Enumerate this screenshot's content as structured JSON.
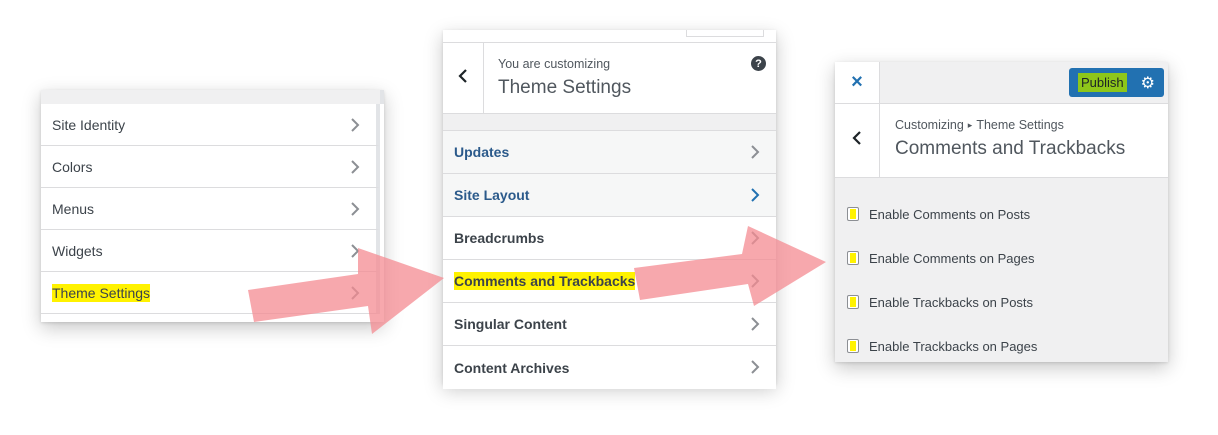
{
  "panel1": {
    "items": [
      {
        "label": "Site Identity"
      },
      {
        "label": "Colors"
      },
      {
        "label": "Menus"
      },
      {
        "label": "Widgets"
      },
      {
        "label": "Theme Settings",
        "highlighted": true
      }
    ]
  },
  "panel2": {
    "header": {
      "subtitle": "You are customizing",
      "title": "Theme Settings",
      "help_icon": "?"
    },
    "items": [
      {
        "label": "Updates"
      },
      {
        "label": "Site Layout"
      },
      {
        "label": "Breadcrumbs"
      },
      {
        "label": "Comments and Trackbacks",
        "highlighted": true
      },
      {
        "label": "Singular Content"
      },
      {
        "label": "Content Archives"
      }
    ]
  },
  "panel3": {
    "close_icon": "×",
    "publish_label": "Publish",
    "gear_icon": "⚙",
    "breadcrumb": {
      "root": "Customizing",
      "separator": "▸",
      "parent": "Theme Settings"
    },
    "title": "Comments and Trackbacks",
    "options": [
      {
        "label": "Enable Comments on Posts",
        "checked": false
      },
      {
        "label": "Enable Comments on Pages",
        "checked": false
      },
      {
        "label": "Enable Trackbacks on Posts",
        "checked": false
      },
      {
        "label": "Enable Trackbacks on Pages",
        "checked": false
      }
    ]
  },
  "colors": {
    "highlight": "#fff200",
    "publish_green": "#8ec61a",
    "wp_blue": "#2271b1",
    "link_blue": "#2b5a8b",
    "arrow_pink": "#f59a9f"
  }
}
